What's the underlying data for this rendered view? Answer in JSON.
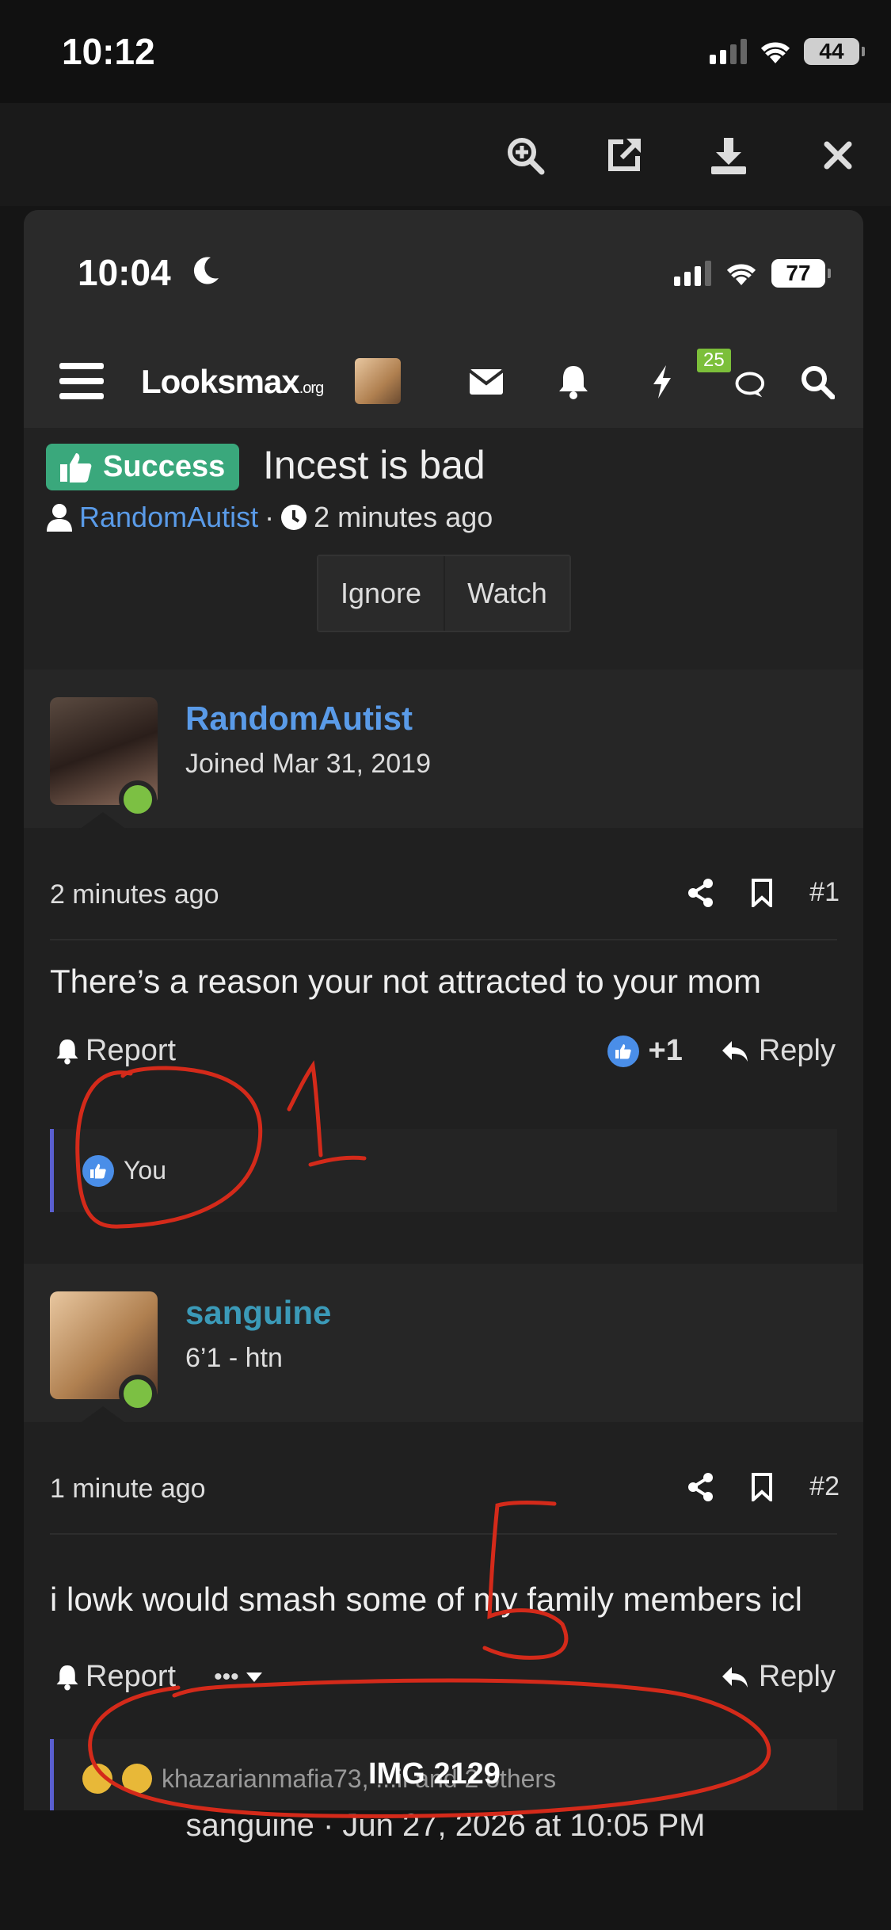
{
  "outer_status": {
    "time": "10:12",
    "battery": "44"
  },
  "viewer": {
    "icons": [
      "zoom-in-icon",
      "external-link-icon",
      "download-icon",
      "close-icon"
    ]
  },
  "inner_status": {
    "time": "10:04",
    "battery": "77"
  },
  "nav": {
    "logo_main": "Looksmax",
    "logo_suffix": ".org",
    "badge": "25"
  },
  "thread": {
    "prefix": "Success",
    "title": "Incest is bad",
    "author": "RandomAutist",
    "separator": "·",
    "time": "2 minutes ago",
    "buttons": [
      "Ignore",
      "Watch"
    ]
  },
  "posts": [
    {
      "username": "RandomAutist",
      "user_title": "Joined Mar 31, 2019",
      "name_color": "#5a9be8",
      "time": "2 minutes ago",
      "number": "#1",
      "body": "There’s a reason your not attracted to your mom",
      "report": "Report",
      "reaction_count": "+1",
      "reply": "Reply",
      "reactions_text": "You"
    },
    {
      "username": "sanguine",
      "user_title": "6’1 - htn",
      "name_color": "#3b9ab8",
      "time": "1 minute ago",
      "number": "#2",
      "body": "i lowk would smash some of my family members icl",
      "report": "Report",
      "more": "•••",
      "reply": "Reply",
      "reactions_text": "khazarianmafia73, ...il and 2 others"
    }
  ],
  "image_label": "IMG 2129",
  "caption": "sanguine · Jun 27, 2026 at 10:05 PM",
  "annotations": [
    "1",
    "5"
  ]
}
